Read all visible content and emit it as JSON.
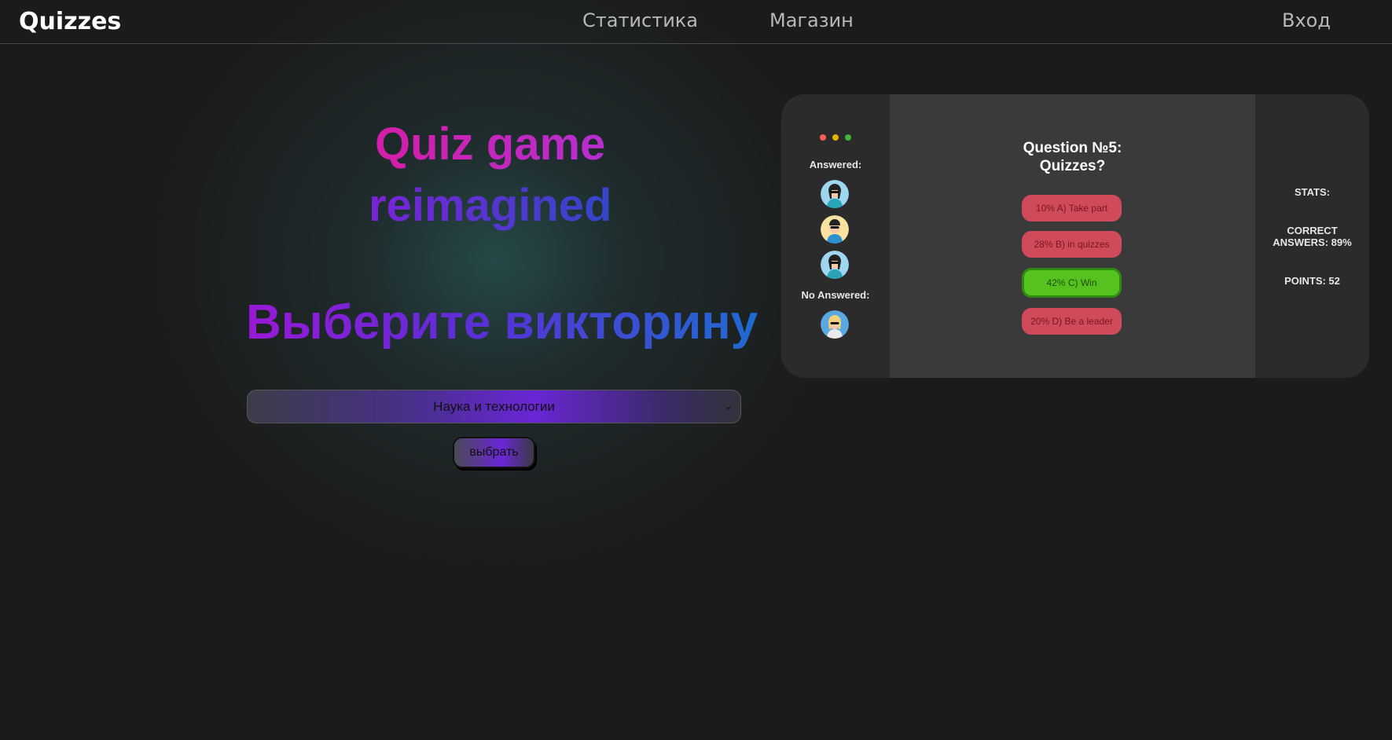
{
  "header": {
    "brand": "Quizzes",
    "nav": [
      "Статистика",
      "Магазин"
    ],
    "login": "Вход"
  },
  "hero": {
    "line1": "Quiz game",
    "line2": "reimagined",
    "line3": "Выберите викторину"
  },
  "selector": {
    "selected": "Наука и технологии",
    "button": "выбрать"
  },
  "preview": {
    "answered_label": "Answered:",
    "no_answered_label": "No Answered:",
    "question": "Question №5:",
    "question_sub": "Quizzes?",
    "answers": [
      {
        "percent": 10,
        "label": "10% A) Take part",
        "correct": false
      },
      {
        "percent": 28,
        "label": "28% B) in quizzes",
        "correct": false
      },
      {
        "percent": 42,
        "label": "42% C) Win",
        "correct": true
      },
      {
        "percent": 20,
        "label": "20% D) Be a leader",
        "correct": false
      }
    ],
    "stats_label": "STATS:",
    "correct_answers": "CORRECT ANSWERS: 89%",
    "points": "POINTS: 52",
    "colors": {
      "dot_red": "#ff5f56",
      "dot_yellow": "#e0b400",
      "dot_green": "#3fb83a",
      "answer_wrong": "#cf4a5a",
      "answer_correct": "#56c21f"
    }
  }
}
